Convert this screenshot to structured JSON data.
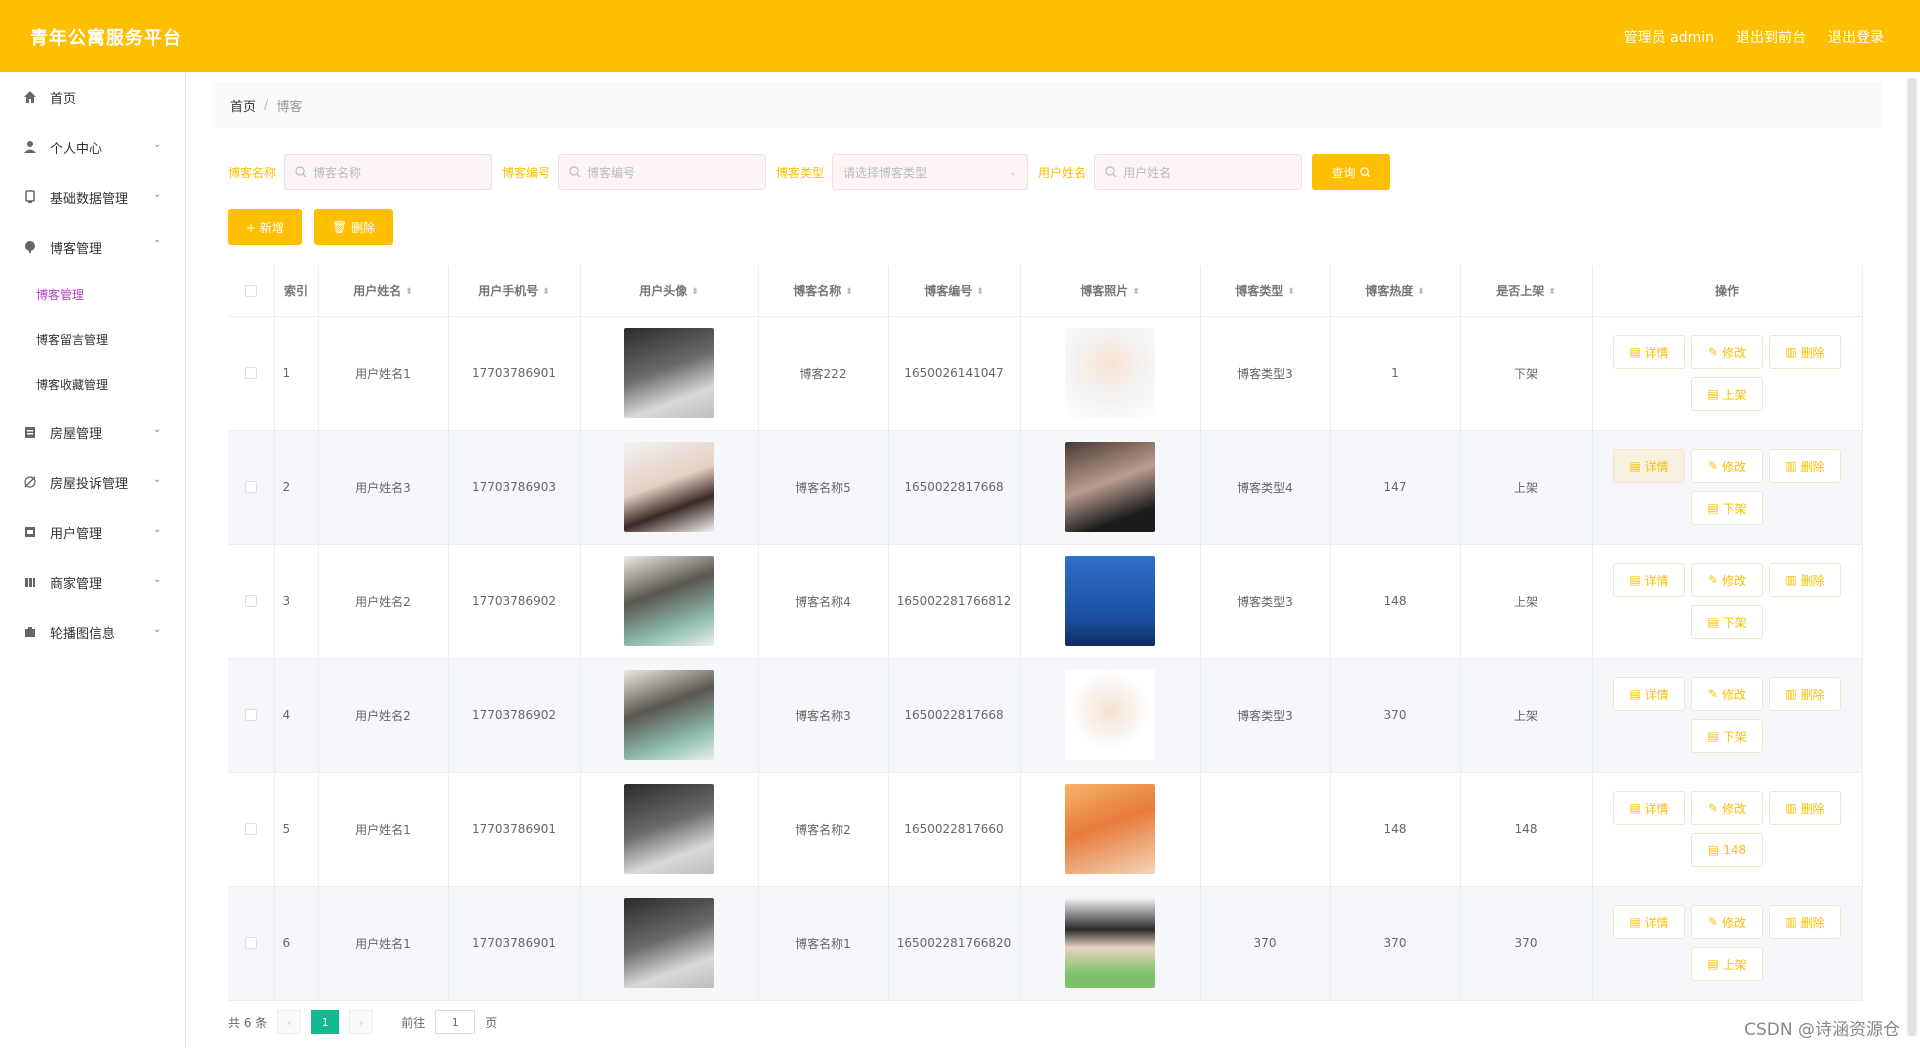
{
  "header": {
    "title": "青年公寓服务平台",
    "admin_label": "管理员 admin",
    "back_label": "退出到前台",
    "logout_label": "退出登录"
  },
  "sidebar": {
    "items": [
      {
        "label": "首页",
        "icon": "home-icon",
        "has_children": false
      },
      {
        "label": "个人中心",
        "icon": "user-icon",
        "has_children": true
      },
      {
        "label": "基础数据管理",
        "icon": "database-icon",
        "has_children": true
      },
      {
        "label": "博客管理",
        "icon": "blog-icon",
        "has_children": true,
        "expanded": true,
        "children": [
          {
            "label": "博客管理",
            "active": true
          },
          {
            "label": "博客留言管理",
            "active": false
          },
          {
            "label": "博客收藏管理",
            "active": false
          }
        ]
      },
      {
        "label": "房屋管理",
        "icon": "house-icon",
        "has_children": true
      },
      {
        "label": "房屋投诉管理",
        "icon": "complaint-icon",
        "has_children": true
      },
      {
        "label": "用户管理",
        "icon": "users-icon",
        "has_children": true
      },
      {
        "label": "商家管理",
        "icon": "shop-icon",
        "has_children": true
      },
      {
        "label": "轮播图信息",
        "icon": "carousel-icon",
        "has_children": true
      }
    ]
  },
  "breadcrumb": {
    "home": "首页",
    "current": "博客"
  },
  "search": {
    "blog_name_label": "博客名称",
    "blog_name_placeholder": "博客名称",
    "blog_no_label": "博客编号",
    "blog_no_placeholder": "博客编号",
    "blog_type_label": "博客类型",
    "blog_type_placeholder": "请选择博客类型",
    "user_name_label": "用户姓名",
    "user_name_placeholder": "用户姓名",
    "query_label": "查询"
  },
  "actions": {
    "add_label": "+ 新增",
    "delete_label": "删除"
  },
  "table": {
    "headers": [
      "",
      "索引",
      "用户姓名",
      "用户手机号",
      "用户头像",
      "博客名称",
      "博客编号",
      "博客照片",
      "博客类型",
      "博客热度",
      "是否上架",
      "操作"
    ],
    "op_labels": {
      "detail": "详情",
      "edit": "修改",
      "delete": "删除",
      "up": "上架",
      "down": "下架"
    },
    "rows": [
      {
        "index": "1",
        "user_name": "用户姓名1",
        "phone": "17703786901",
        "blog_name": "博客222",
        "blog_no": "1650026141047",
        "blog_type": "博客类型3",
        "heat": "1",
        "status": "下架",
        "op": "上架"
      },
      {
        "index": "2",
        "user_name": "用户姓名3",
        "phone": "17703786903",
        "blog_name": "博客名称5",
        "blog_no": "1650022817668",
        "blog_type": "博客类型4",
        "heat": "147",
        "status": "上架",
        "op": "下架"
      },
      {
        "index": "3",
        "user_name": "用户姓名2",
        "phone": "17703786902",
        "blog_name": "博客名称4",
        "blog_no": "165002281766812",
        "blog_type": "博客类型3",
        "heat": "148",
        "status": "上架",
        "op": "下架"
      },
      {
        "index": "4",
        "user_name": "用户姓名2",
        "phone": "17703786902",
        "blog_name": "博客名称3",
        "blog_no": "1650022817668",
        "blog_type": "博客类型3",
        "heat": "370",
        "status": "上架",
        "op": "下架"
      },
      {
        "index": "5",
        "user_name": "用户姓名1",
        "phone": "17703786901",
        "blog_name": "博客名称2",
        "blog_no": "1650022817660",
        "blog_type": "",
        "heat": "148",
        "status": "148",
        "op": "148"
      },
      {
        "index": "6",
        "user_name": "用户姓名1",
        "phone": "17703786901",
        "blog_name": "博客名称1",
        "blog_no": "165002281766820",
        "blog_type": "370",
        "heat": "370",
        "status": "370",
        "op": "上架"
      }
    ]
  },
  "pager": {
    "total": "共 6 条",
    "current": "1",
    "goto_label": "前往",
    "goto_value": "1",
    "page_unit": "页"
  },
  "watermark": "CSDN @诗涵资源仓"
}
